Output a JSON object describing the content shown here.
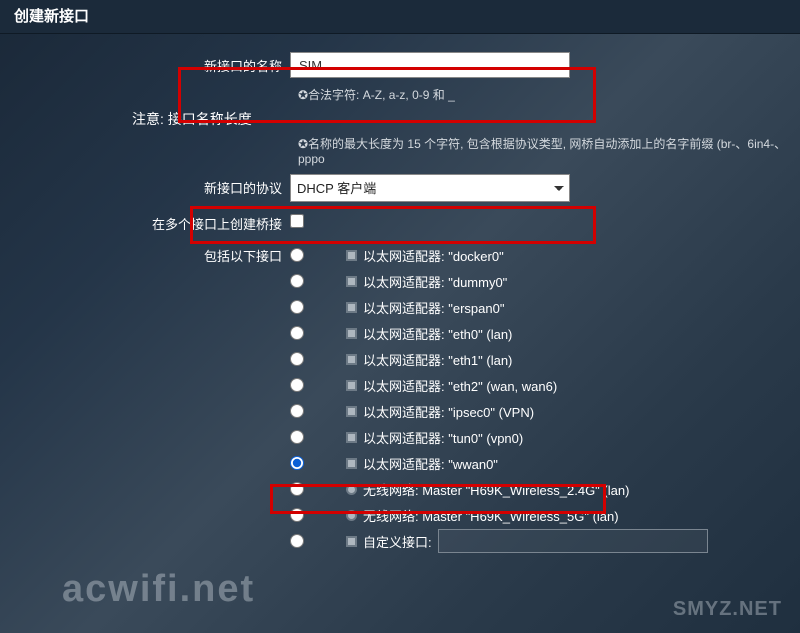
{
  "header": {
    "title": "创建新接口"
  },
  "name_row": {
    "label": "新接口的名称",
    "value": "SIM",
    "hint_prefix": "✪合法字符: ",
    "hint_rest": "A-Z, a-z, 0-9 和 _"
  },
  "notice": {
    "label": "注意:",
    "text": "接口名称长度"
  },
  "name_len_hint": "✪名称的最大长度为 15 个字符, 包含根据协议类型, 网桥自动添加上的名字前缀 (br-、6in4-、pppo",
  "proto_row": {
    "label": "新接口的协议",
    "selected": "DHCP 客户端"
  },
  "bridge_row": {
    "label": "在多个接口上创建桥接",
    "checked": false
  },
  "iface_label": "包括以下接口",
  "interfaces": [
    {
      "label": "以太网适配器: \"docker0\"",
      "type": "eth",
      "selected": false
    },
    {
      "label": "以太网适配器: \"dummy0\"",
      "type": "eth",
      "selected": false
    },
    {
      "label": "以太网适配器: \"erspan0\"",
      "type": "eth",
      "selected": false
    },
    {
      "label": "以太网适配器: \"eth0\" (lan)",
      "type": "eth",
      "selected": false
    },
    {
      "label": "以太网适配器: \"eth1\" (lan)",
      "type": "eth",
      "selected": false
    },
    {
      "label": "以太网适配器: \"eth2\" (wan, wan6)",
      "type": "eth",
      "selected": false
    },
    {
      "label": "以太网适配器: \"ipsec0\" (VPN)",
      "type": "eth",
      "selected": false
    },
    {
      "label": "以太网适配器: \"tun0\" (vpn0)",
      "type": "eth",
      "selected": false
    },
    {
      "label": "以太网适配器: \"wwan0\"",
      "type": "eth",
      "selected": true
    },
    {
      "label": "无线网络: Master \"H69K_Wireless_2.4G\" (lan)",
      "type": "wl",
      "selected": false
    },
    {
      "label": "无线网络: Master \"H69K_Wireless_5G\" (lan)",
      "type": "wl",
      "selected": false
    }
  ],
  "custom_iface": {
    "label": "自定义接口:",
    "value": ""
  },
  "watermarks": {
    "left": "acwifi.net",
    "right": "SMYZ.NET"
  }
}
